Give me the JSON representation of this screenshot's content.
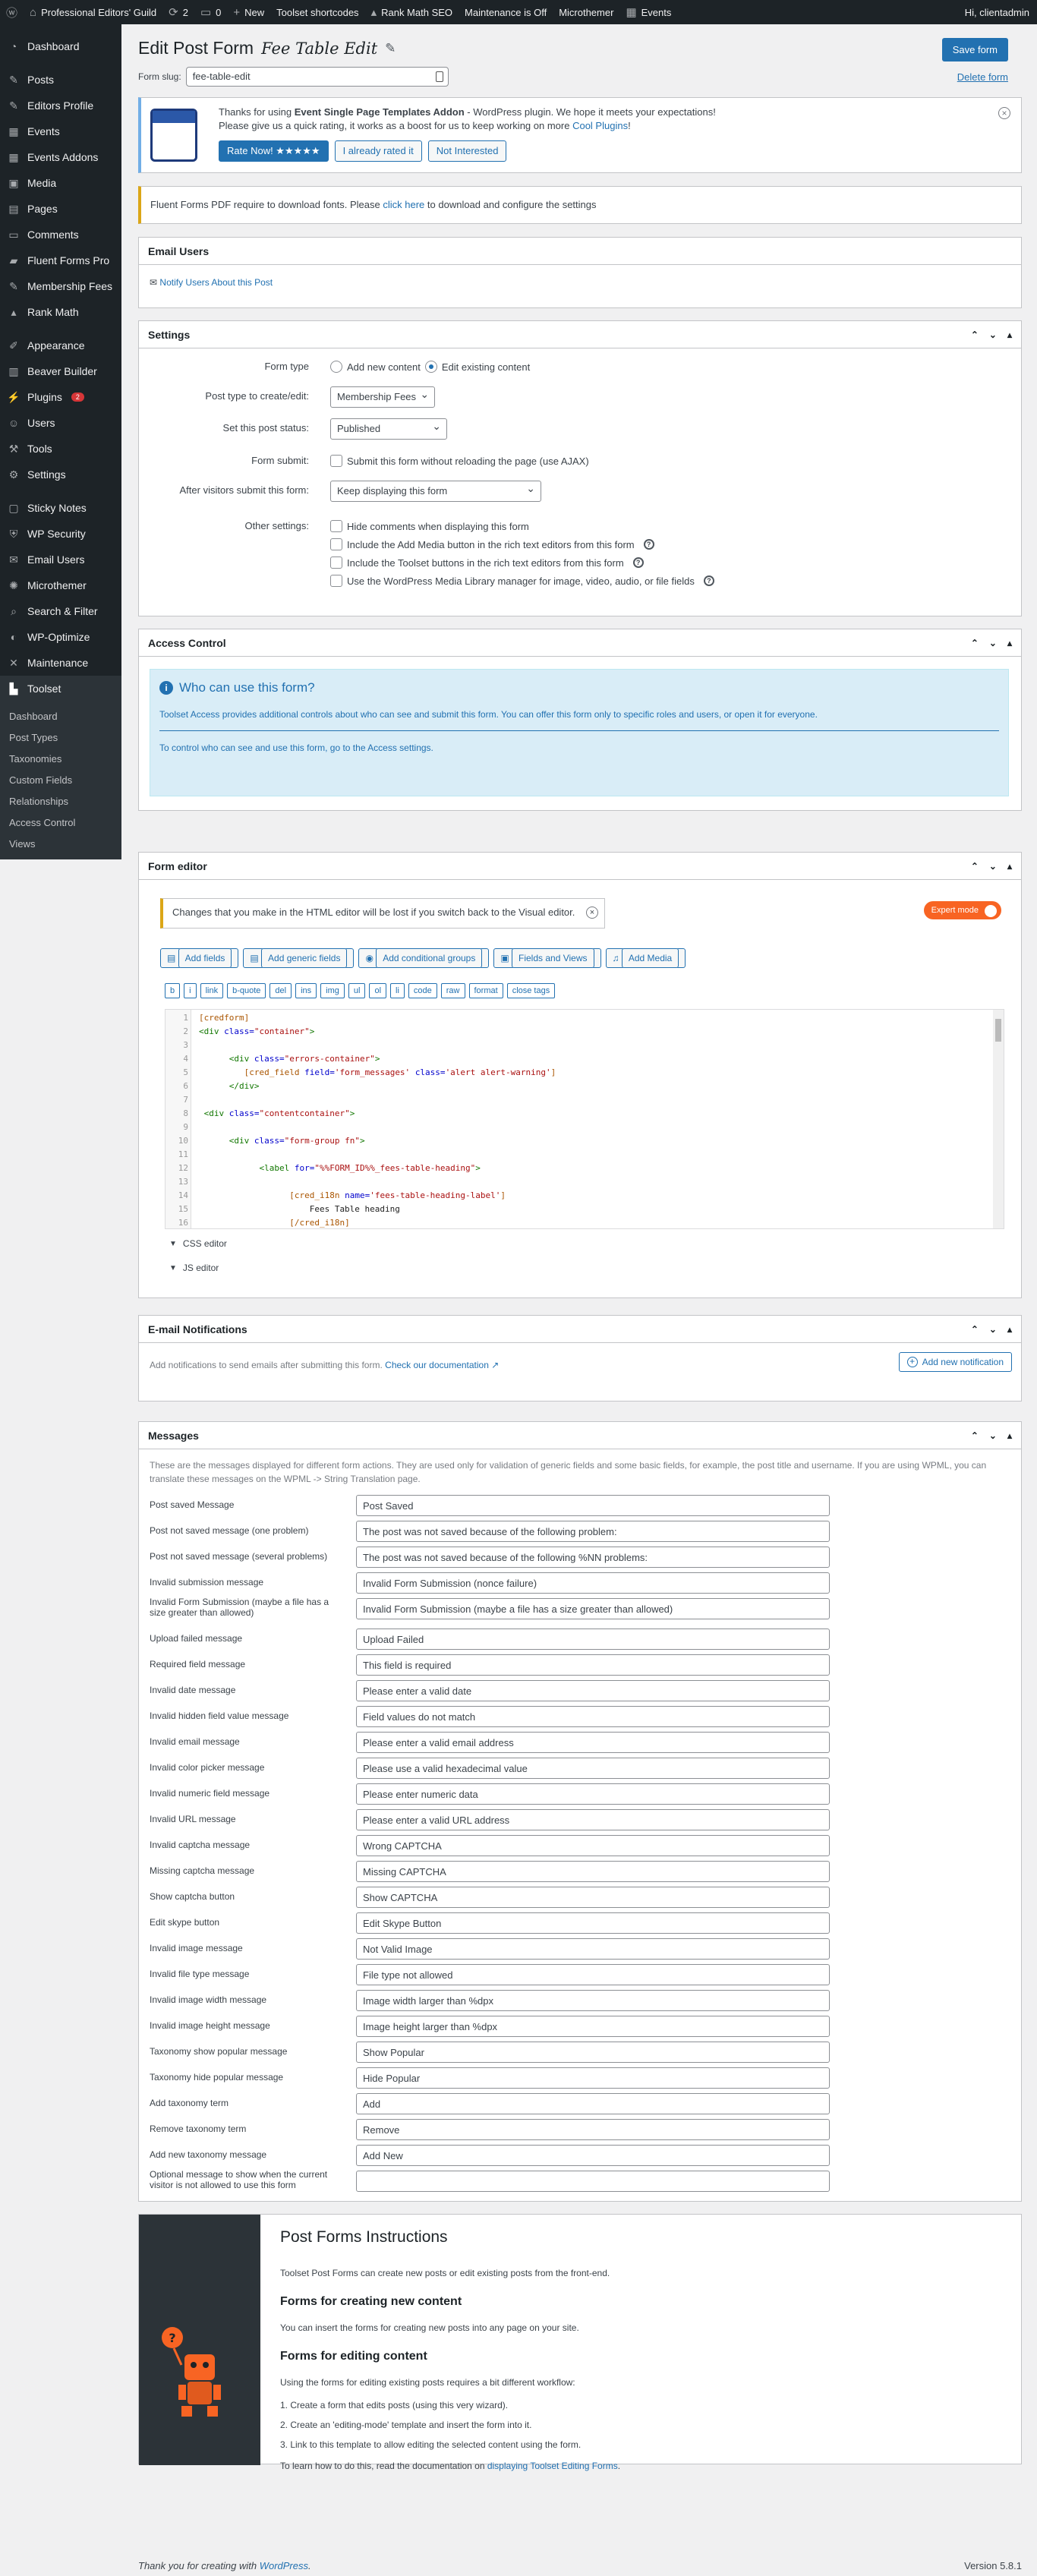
{
  "adminbar": {
    "site": "Professional Editors' Guild",
    "updates": "2",
    "comments": "0",
    "new": "New",
    "toolset": "Toolset shortcodes",
    "rankmath": "Rank Math SEO",
    "maintenance": "Maintenance is Off",
    "microthemer": "Microthemer",
    "events": "Events",
    "greeting": "Hi, clientadmin"
  },
  "sidebar": {
    "items": [
      "Dashboard",
      "Posts",
      "Editors Profile",
      "Events",
      "Events Addons",
      "Media",
      "Pages",
      "Comments",
      "Fluent Forms Pro",
      "Membership Fees",
      "Rank Math",
      "Appearance",
      "Beaver Builder",
      "Plugins",
      "Users",
      "Tools",
      "Settings",
      "Sticky Notes",
      "WP Security",
      "Email Users",
      "Microthemer",
      "Search & Filter",
      "WP-Optimize",
      "Maintenance",
      "Toolset"
    ],
    "plugins_badge": "2",
    "sub": [
      "Dashboard",
      "Post Types",
      "Taxonomies",
      "Custom Fields",
      "Relationships",
      "Access Control",
      "Views"
    ]
  },
  "page": {
    "title": "Edit Post Form",
    "form_name": "Fee Table Edit",
    "slug_label": "Form slug:",
    "slug": "fee-table-edit",
    "save": "Save form",
    "delete": "Delete form"
  },
  "rate_notice": {
    "line1_a": "Thanks for using ",
    "line1_b": "Event Single Page Templates Addon",
    "line1_c": " - WordPress plugin. We hope it meets your expectations!",
    "line2_a": "Please give us a quick rating, it works as a boost for us to keep working on more ",
    "line2_link": "Cool Plugins",
    "line2_b": "!",
    "btn_rate": "Rate Now! ★★★★★",
    "btn_rated": "I already rated it",
    "btn_not": "Not Interested"
  },
  "font_notice": {
    "a": "Fluent Forms PDF require to download fonts. Please ",
    "link": "click here",
    "b": " to download and configure the settings"
  },
  "email_users": {
    "title": "Email Users",
    "link": "Notify Users About this Post"
  },
  "settings": {
    "title": "Settings",
    "form_type_label": "Form type",
    "opt_new": "Add new content",
    "opt_edit": "Edit existing content",
    "post_type_label": "Post type to create/edit:",
    "post_type": "Membership Fees",
    "status_label": "Set this post status:",
    "status": "Published",
    "submit_label": "Form submit:",
    "submit_opt": "Submit this form without reloading the page (use AJAX)",
    "after_label": "After visitors submit this form:",
    "after": "Keep displaying this form",
    "other_label": "Other settings:",
    "other": [
      "Hide comments when displaying this form",
      "Include the Add Media button in the rich text editors from this form",
      "Include the Toolset buttons in the rich text editors from this form",
      "Use the WordPress Media Library manager for image, video, audio, or file fields"
    ]
  },
  "access": {
    "title": "Access Control",
    "heading": "Who can use this form?",
    "p1": "Toolset Access provides additional controls about who can see and submit this form. You can offer this form only to specific roles and users, or open it for everyone.",
    "p2_a": "To control who can see and use this form, go to the ",
    "p2_link": "Access settings",
    "p2_b": "."
  },
  "editor": {
    "title": "Form editor",
    "warning": "Changes that you make in the HTML editor will be lost if you switch back to the Visual editor.",
    "expert": "Expert mode",
    "buttons": [
      "Add fields",
      "Add generic fields",
      "Add conditional groups",
      "Fields and Views",
      "Add Media"
    ],
    "qtags": [
      "b",
      "i",
      "link",
      "b-quote",
      "del",
      "ins",
      "img",
      "ul",
      "ol",
      "li",
      "code",
      "raw",
      "format",
      "close tags"
    ],
    "css_editor": "CSS editor",
    "js_editor": "JS editor"
  },
  "notifications": {
    "title": "E-mail Notifications",
    "text_a": "Add notifications to send emails after submitting this form. ",
    "link": "Check our documentation",
    "button": "Add new notification"
  },
  "messages": {
    "title": "Messages",
    "intro": "These are the messages displayed for different form actions. They are used only for validation of generic fields and some basic fields, for example, the post title and username. If you are using WPML, you can translate these messages on the WPML -> String Translation page.",
    "rows": [
      {
        "label": "Post saved Message",
        "value": "Post Saved"
      },
      {
        "label": "Post not saved message (one problem)",
        "value": "The post was not saved because of the following problem:"
      },
      {
        "label": "Post not saved message (several problems)",
        "value": "The post was not saved because of the following %NN problems:"
      },
      {
        "label": "Invalid submission message",
        "value": "Invalid Form Submission (nonce failure)"
      },
      {
        "label": "Invalid Form Submission (maybe a file has a size greater than allowed)",
        "value": "Invalid Form Submission (maybe a file has a size greater than allowed)"
      },
      {
        "label": "Upload failed message",
        "value": "Upload Failed"
      },
      {
        "label": "Required field message",
        "value": "This field is required"
      },
      {
        "label": "Invalid date message",
        "value": "Please enter a valid date"
      },
      {
        "label": "Invalid hidden field value message",
        "value": "Field values do not match"
      },
      {
        "label": "Invalid email message",
        "value": "Please enter a valid email address"
      },
      {
        "label": "Invalid color picker message",
        "value": "Please use a valid hexadecimal value"
      },
      {
        "label": "Invalid numeric field message",
        "value": "Please enter numeric data"
      },
      {
        "label": "Invalid URL message",
        "value": "Please enter a valid URL address"
      },
      {
        "label": "Invalid captcha message",
        "value": "Wrong CAPTCHA"
      },
      {
        "label": "Missing captcha message",
        "value": "Missing CAPTCHA"
      },
      {
        "label": "Show captcha button",
        "value": "Show CAPTCHA"
      },
      {
        "label": "Edit skype button",
        "value": "Edit Skype Button"
      },
      {
        "label": "Invalid image message",
        "value": "Not Valid Image"
      },
      {
        "label": "Invalid file type message",
        "value": "File type not allowed"
      },
      {
        "label": "Invalid image width message",
        "value": "Image width larger than %dpx"
      },
      {
        "label": "Invalid image height message",
        "value": "Image height larger than %dpx"
      },
      {
        "label": "Taxonomy show popular message",
        "value": "Show Popular"
      },
      {
        "label": "Taxonomy hide popular message",
        "value": "Hide Popular"
      },
      {
        "label": "Add taxonomy term",
        "value": "Add"
      },
      {
        "label": "Remove taxonomy term",
        "value": "Remove"
      },
      {
        "label": "Add new taxonomy message",
        "value": "Add New"
      },
      {
        "label": "Optional message to show when the current visitor is not allowed to use this form",
        "value": ""
      }
    ]
  },
  "instructions": {
    "title": "Post Forms Instructions",
    "intro": "Toolset Post Forms can create new posts or edit existing posts from the front-end.",
    "h_new": "Forms for creating new content",
    "p_new": "You can insert the forms for creating new posts into any page on your site.",
    "h_edit": "Forms for editing content",
    "p_edit": "Using the forms for editing existing posts requires a bit different workflow:",
    "steps": [
      "1. Create a form that edits posts (using this very wizard).",
      "2. Create an 'editing-mode' template and insert the form into it.",
      "3. Link to this template to allow editing the selected content using the form."
    ],
    "learn_a": "To learn how to do this, read the documentation on ",
    "learn_link": "displaying Toolset Editing Forms",
    "learn_b": "."
  },
  "footer": {
    "a": "Thank you for creating with ",
    "link": "WordPress",
    "b": ".",
    "version": "Version 5.8.1"
  }
}
